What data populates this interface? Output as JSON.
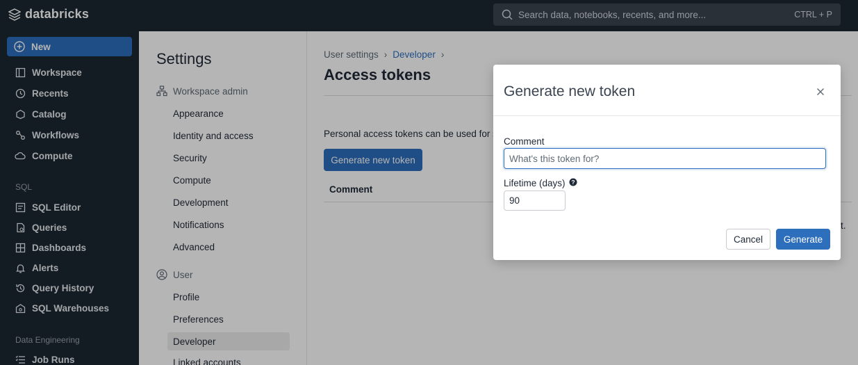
{
  "app": {
    "brand": "databricks",
    "search_placeholder": "Search data, notebooks, recents, and more...",
    "search_shortcut": "CTRL + P",
    "accent_color": "#2d6fbd",
    "nav_bg_color": "#1b2632"
  },
  "leftnav": {
    "new_label": "New",
    "items": [
      {
        "label": "Workspace",
        "icon": "workspace-icon"
      },
      {
        "label": "Recents",
        "icon": "clock-icon"
      },
      {
        "label": "Catalog",
        "icon": "catalog-icon"
      },
      {
        "label": "Workflows",
        "icon": "workflows-icon"
      },
      {
        "label": "Compute",
        "icon": "cloud-icon"
      }
    ],
    "sql_section": "SQL",
    "sql_items": [
      {
        "label": "SQL Editor",
        "icon": "sql-editor-icon"
      },
      {
        "label": "Queries",
        "icon": "queries-icon"
      },
      {
        "label": "Dashboards",
        "icon": "dashboards-icon"
      },
      {
        "label": "Alerts",
        "icon": "bell-icon"
      },
      {
        "label": "Query History",
        "icon": "history-icon"
      },
      {
        "label": "SQL Warehouses",
        "icon": "warehouse-icon"
      }
    ],
    "de_section": "Data Engineering",
    "de_items": [
      {
        "label": "Job Runs",
        "icon": "job-runs-icon"
      }
    ]
  },
  "settings": {
    "title": "Settings",
    "workspace_admin": "Workspace admin",
    "admin_items": [
      "Appearance",
      "Identity and access",
      "Security",
      "Compute",
      "Development",
      "Notifications",
      "Advanced"
    ],
    "user_group": "User",
    "user_items": [
      "Profile",
      "Preferences",
      "Developer",
      "Linked accounts"
    ]
  },
  "main": {
    "breadcrumb": [
      "User settings",
      "Developer"
    ],
    "title": "Access tokens",
    "description": "Personal access tokens can be used for sec",
    "generate_button": "Generate new token",
    "table_header": "Comment",
    "trailing_text": "t."
  },
  "modal": {
    "title": "Generate new token",
    "comment_label": "Comment",
    "comment_placeholder": "What's this token for?",
    "lifetime_label": "Lifetime (days)",
    "lifetime_value": "90",
    "cancel_label": "Cancel",
    "generate_label": "Generate"
  }
}
